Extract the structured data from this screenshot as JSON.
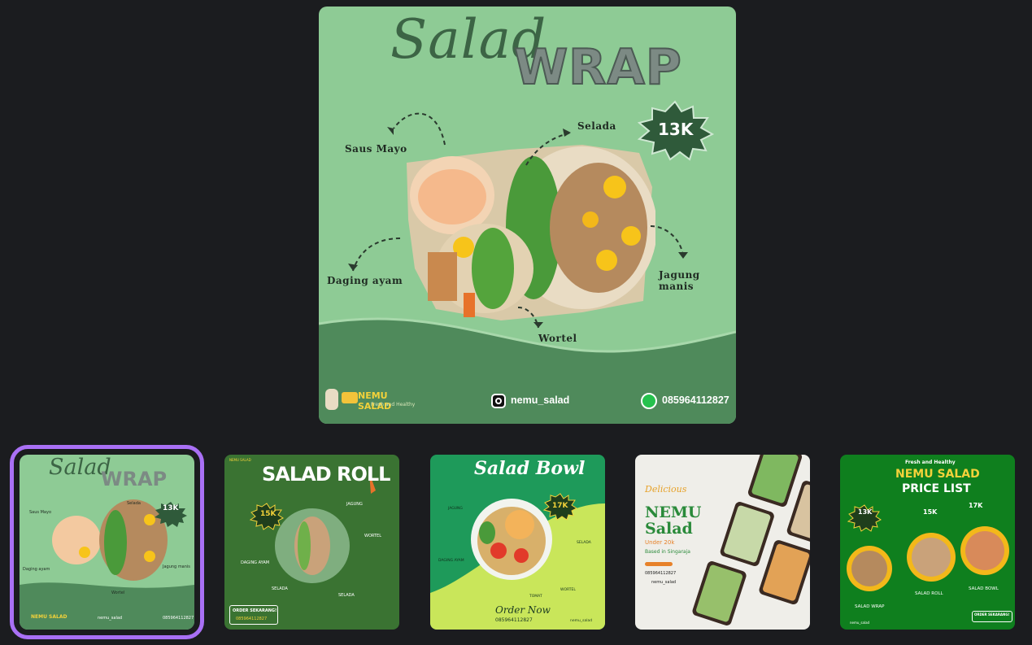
{
  "main": {
    "title_line1": "Salad",
    "title_line2": "WRAP",
    "price": "13K",
    "labels": {
      "saus_mayo": "Saus Mayo",
      "selada": "Selada",
      "daging_ayam": "Daging ayam",
      "jagung_manis": "Jagung manis",
      "wortel": "Wortel"
    },
    "brand": "NEMU SALAD",
    "brand_tagline": "Fresh and Healthy",
    "instagram": "nemu_salad",
    "phone": "085964112827"
  },
  "thumbnails": [
    {
      "id": "salad-wrap",
      "selected": true,
      "title_line1": "Salad",
      "title_line2": "WRAP",
      "price": "13K",
      "brand": "NEMU SALAD",
      "ig": "nemu_salad",
      "phone": "085964112827",
      "labels": [
        "Saus Mayo",
        "Selada",
        "Daging ayam",
        "Jagung manis",
        "Wortel"
      ]
    },
    {
      "id": "salad-roll",
      "selected": false,
      "title": "SALAD ROLL",
      "price": "15K",
      "brand": "NEMU SALAD",
      "cta": "ORDER SEKARANG!",
      "phone": "085964112827",
      "labels": [
        "JAGUNG",
        "WORTEL",
        "DAGING AYAM",
        "SELADA",
        "SELADA"
      ]
    },
    {
      "id": "salad-bowl",
      "selected": false,
      "title": "Salad Bowl",
      "price": "17K",
      "cta": "Order Now",
      "phone": "085964112827",
      "ig": "nemu_salad",
      "labels": [
        "JAGUNG",
        "SELADA",
        "DAGING AYAM",
        "WORTEL",
        "TOMAT"
      ]
    },
    {
      "id": "nemu-salad-promo",
      "selected": false,
      "script": "Delicious",
      "title_line1": "NEMU",
      "title_line2": "Salad",
      "under": "Under 20k",
      "based": "Based in Singaraja",
      "phone": "085964112827",
      "ig": "nemu_salad"
    },
    {
      "id": "price-list",
      "selected": false,
      "tagline": "Fresh and Healthy",
      "title_line1": "NEMU SALAD",
      "title_line2": "PRICE LIST",
      "prices": [
        "13K",
        "15K",
        "17K"
      ],
      "items": [
        "SALAD WRAP",
        "SALAD ROLL",
        "SALAD BOWL"
      ],
      "cta": "ORDER SEKARANG!",
      "ig": "nemu_salad"
    }
  ],
  "colors": {
    "selection": "#a970f5",
    "main_bg": "#8ecb95",
    "dark_green": "#3f6b4a"
  }
}
